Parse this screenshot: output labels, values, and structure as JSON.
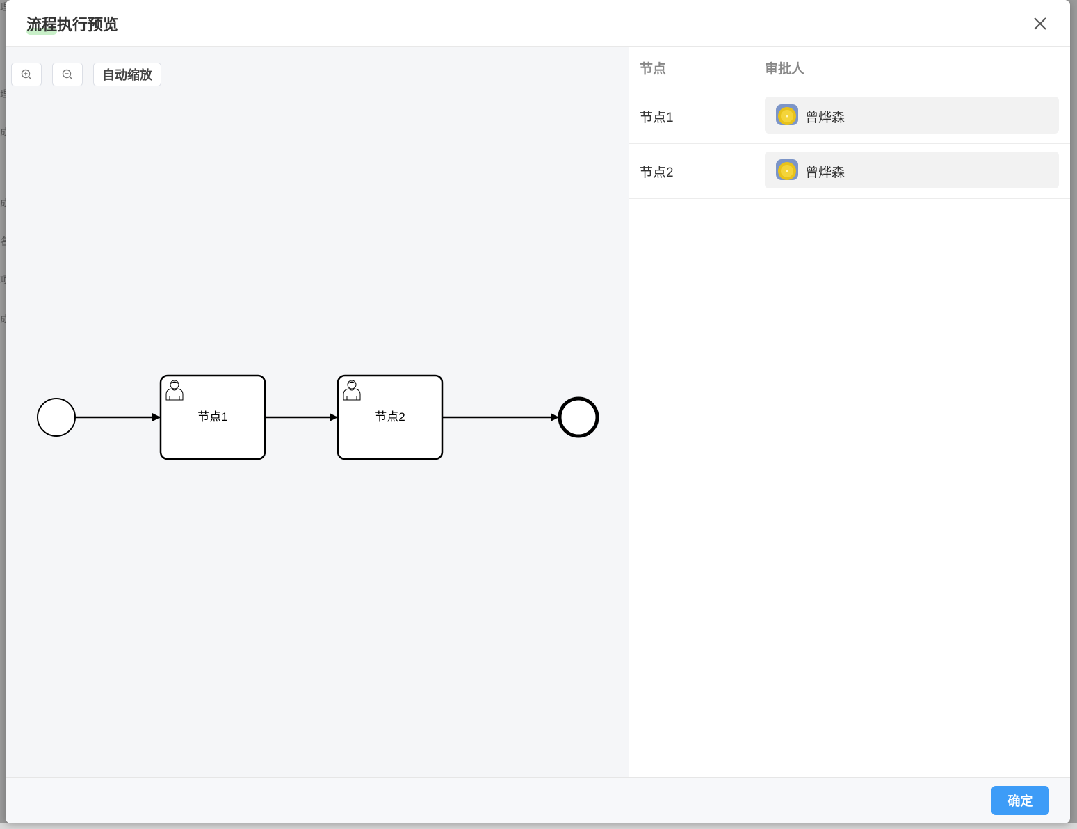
{
  "dialog": {
    "title": "流程执行预览",
    "close_icon": "close-icon"
  },
  "toolbar": {
    "zoom_in_icon": "zoom-in-icon",
    "zoom_out_icon": "zoom-out-icon",
    "auto_zoom_label": "自动缩放"
  },
  "diagram": {
    "nodes": [
      {
        "type": "start-event"
      },
      {
        "type": "user-task",
        "label": "节点1",
        "icon": "user-icon"
      },
      {
        "type": "user-task",
        "label": "节点2",
        "icon": "user-icon"
      },
      {
        "type": "end-event"
      }
    ]
  },
  "table": {
    "headers": {
      "node": "节点",
      "approver": "审批人"
    },
    "rows": [
      {
        "node": "节点1",
        "approver": "曾烨森",
        "avatar": "lemon-avatar"
      },
      {
        "node": "节点2",
        "approver": "曾烨森",
        "avatar": "lemon-avatar"
      }
    ]
  },
  "footer": {
    "confirm_label": "确定"
  },
  "colors": {
    "primary": "#3d9cf7",
    "canvas_bg": "#f5f6f8",
    "chip_bg": "#f2f2f2"
  }
}
